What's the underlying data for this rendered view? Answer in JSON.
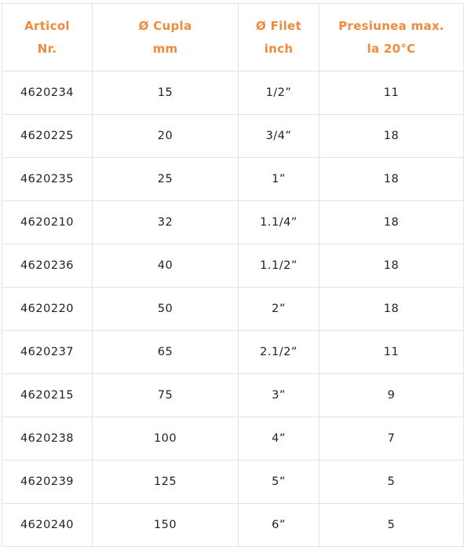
{
  "table": {
    "headers": [
      {
        "line1": "Articol",
        "line2": "Nr."
      },
      {
        "line1": "Ø Cupla",
        "line2": "mm"
      },
      {
        "line1": "Ø Filet",
        "line2": "inch"
      },
      {
        "line1": "Presiunea max.",
        "line2": "la 20°C"
      }
    ],
    "rows": [
      [
        "4620234",
        "15",
        "1/2”",
        "11"
      ],
      [
        "4620225",
        "20",
        "3/4”",
        "18"
      ],
      [
        "4620235",
        "25",
        "1”",
        "18"
      ],
      [
        "4620210",
        "32",
        "1.1/4”",
        "18"
      ],
      [
        "4620236",
        "40",
        "1.1/2”",
        "18"
      ],
      [
        "4620220",
        "50",
        "2”",
        "18"
      ],
      [
        "4620237",
        "65",
        "2.1/2”",
        "11"
      ],
      [
        "4620215",
        "75",
        "3”",
        "9"
      ],
      [
        "4620238",
        "100",
        "4”",
        "7"
      ],
      [
        "4620239",
        "125",
        "5”",
        "5"
      ],
      [
        "4620240",
        "150",
        "6”",
        "5"
      ]
    ]
  },
  "colors": {
    "header_text": "#f08a3c",
    "body_text": "#222222",
    "border": "#e3e3e3"
  }
}
